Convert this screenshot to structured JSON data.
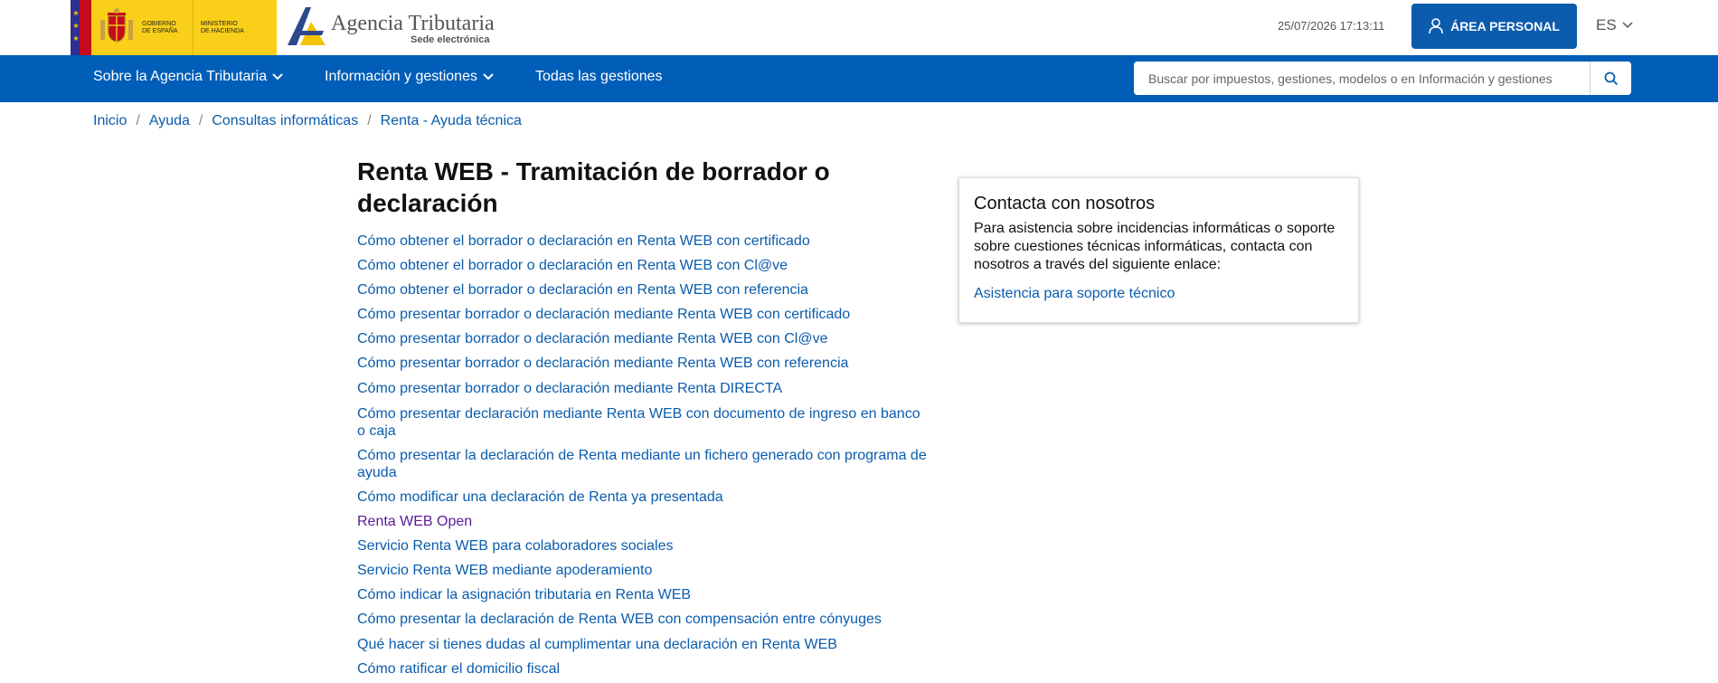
{
  "header": {
    "gov_text_1": "GOBIERNO DE ESPAÑA",
    "gov_text_2": "MINISTERIO DE HACIENDA",
    "brand_title": "Agencia Tributaria",
    "brand_subtitle": "Sede electrónica",
    "datetime": "25/07/2026 17:13:11",
    "area_personal_label": "ÁREA PERSONAL",
    "language": "ES"
  },
  "nav": {
    "items": [
      {
        "label": "Sobre la Agencia Tributaria"
      },
      {
        "label": "Información y gestiones"
      },
      {
        "label": "Todas las gestiones"
      }
    ],
    "search_placeholder": "Buscar por impuestos, gestiones, modelos o en Información y gestiones"
  },
  "breadcrumb": [
    "Inicio",
    "Ayuda",
    "Consultas informáticas",
    "Renta - Ayuda técnica"
  ],
  "main": {
    "title": "Renta WEB - Tramitación de borrador o declaración",
    "links": [
      "Cómo obtener el borrador o declaración en Renta WEB con certificado",
      "Cómo obtener el borrador o declaración en Renta WEB con Cl@ve",
      "Cómo obtener el borrador o declaración en Renta WEB con referencia",
      "Cómo presentar borrador o declaración mediante Renta WEB con certificado",
      "Cómo presentar borrador o declaración mediante Renta WEB con Cl@ve",
      "Cómo presentar borrador o declaración mediante Renta WEB con referencia",
      "Cómo presentar borrador o declaración mediante Renta DIRECTA",
      "Cómo presentar declaración mediante Renta WEB con documento de ingreso en banco o caja",
      "Cómo presentar la declaración de Renta mediante un fichero generado con programa de ayuda",
      "Cómo modificar una declaración de Renta ya presentada",
      "Renta WEB Open",
      "Servicio Renta WEB para colaboradores sociales",
      "Servicio Renta WEB mediante apoderamiento",
      "Cómo indicar la asignación tributaria en Renta WEB",
      "Cómo presentar la declaración de Renta WEB con compensación entre cónyuges",
      "Qué hacer si tienes dudas al cumplimentar una declaración en Renta WEB",
      "Cómo ratificar el domicilio fiscal"
    ]
  },
  "contact": {
    "title": "Contacta con nosotros",
    "text": "Para asistencia sobre incidencias informáticas o soporte sobre cuestiones técnicas informáticas, contacta con nosotros a través del siguiente enlace:",
    "link": "Asistencia para soporte técnico"
  },
  "colors": {
    "nav_blue": "#005eb8",
    "link_blue": "#0b5cad",
    "visited_purple": "#5b1a9a",
    "gov_yellow": "#f9cf19"
  }
}
